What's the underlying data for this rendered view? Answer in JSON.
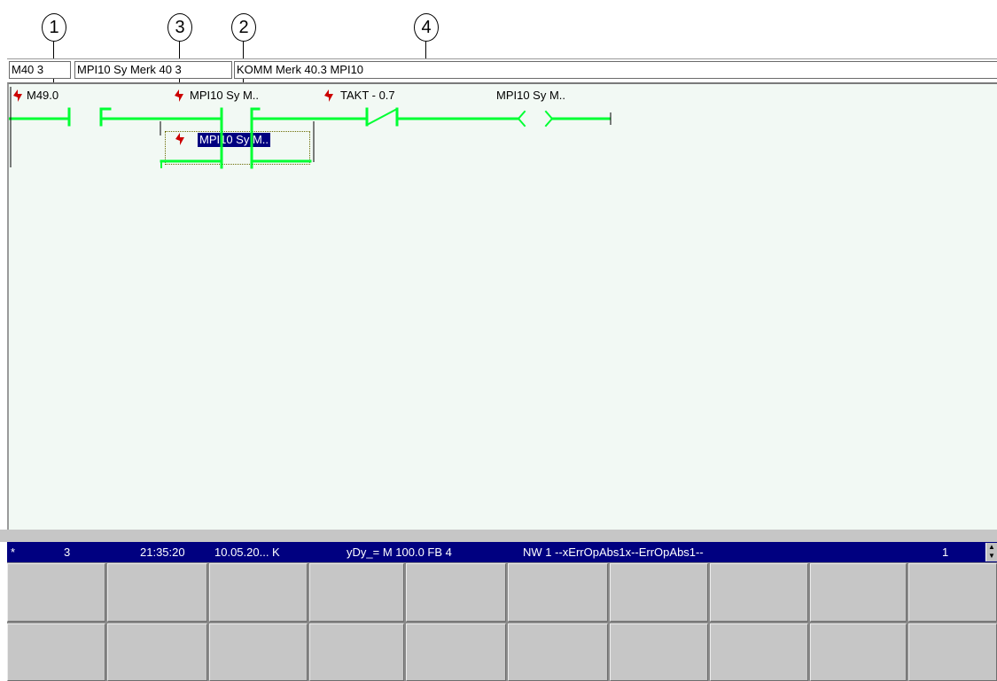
{
  "callouts": [
    "1",
    "3",
    "2",
    "4"
  ],
  "header": {
    "cell1": "M40 3",
    "cell2": "MPI10 Sy Merk 40 3",
    "cell3": "KOMM Merk 40.3 MPI10"
  },
  "ladder": {
    "contact1": "M49.0",
    "contact2": "MPI10 Sy M..",
    "contact3": "TAKT - 0.7",
    "coil": "MPI10 Sy M..",
    "branch_contact": "MPI10 Sy M..",
    "rung_color": "#00ff33",
    "forced_icon": "lightning-icon",
    "forced_color": "#cc0000"
  },
  "status": {
    "marker": "*",
    "count": "3",
    "time": "21:35:20",
    "date": "10.05.20... K",
    "condition": "yDy_= M 100.0  FB 4",
    "network": "NW 1  --xErrOpAbs1x--ErrOpAbs1--",
    "page": "1",
    "bg_color": "#000080"
  }
}
